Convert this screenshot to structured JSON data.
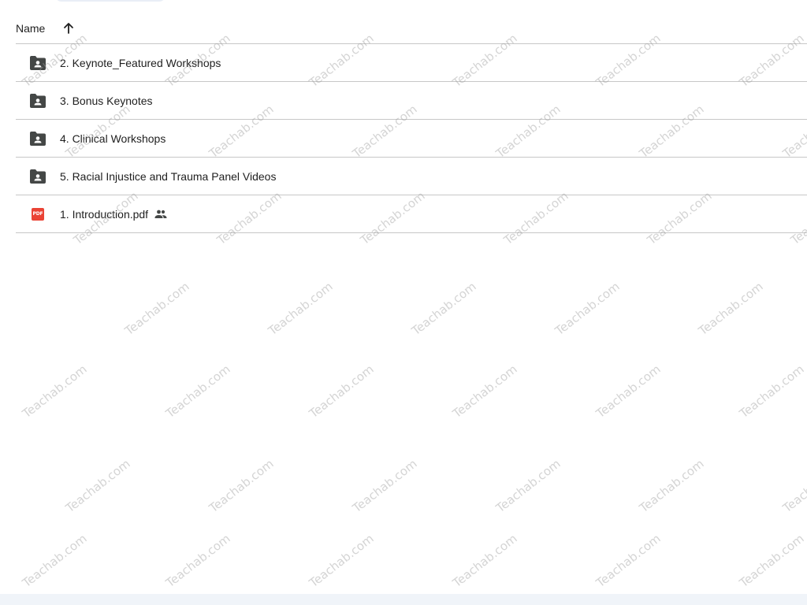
{
  "header": {
    "column_label": "Name",
    "sort_icon": "arrow-up-icon"
  },
  "files": [
    {
      "name": "2. Keynote_Featured Workshops",
      "icon": "shared-folder-icon",
      "shared": false
    },
    {
      "name": "3. Bonus Keynotes",
      "icon": "shared-folder-icon",
      "shared": false
    },
    {
      "name": "4. Clinical Workshops",
      "icon": "shared-folder-icon",
      "shared": false
    },
    {
      "name": "5. Racial Injustice and Trauma Panel Videos",
      "icon": "shared-folder-icon",
      "shared": false
    },
    {
      "name": "1. Introduction.pdf",
      "icon": "pdf-icon",
      "icon_text": "PDF",
      "shared": true,
      "shared_icon": "people-icon"
    }
  ],
  "watermark": "Teachab.com",
  "colors": {
    "folder": "#444746",
    "pdf": "#ea4335",
    "divider": "#c7c7c7"
  }
}
